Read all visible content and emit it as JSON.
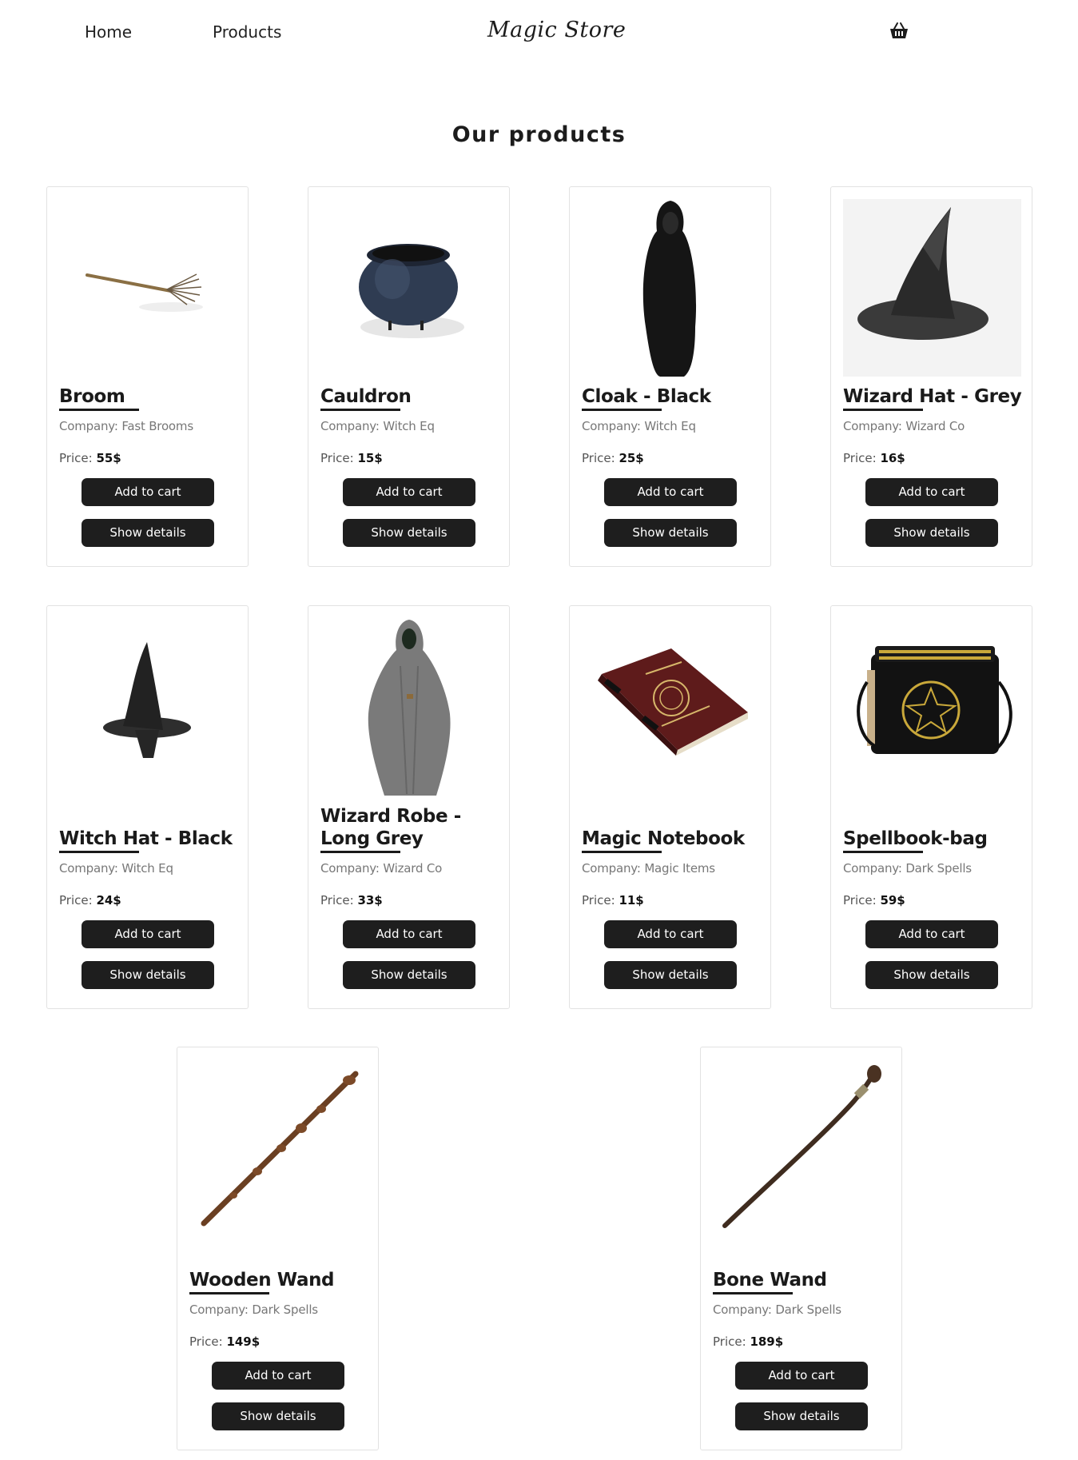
{
  "nav": {
    "home": "Home",
    "products": "Products",
    "logo": "Magic Store"
  },
  "icons": {
    "cart": "basket-icon"
  },
  "page": {
    "title": "Our products"
  },
  "labels": {
    "company": "Company:",
    "price": "Price:",
    "add_to_cart": "Add to cart",
    "show_details": "Show details"
  },
  "products": [
    {
      "name": "Broom",
      "company": "Fast Brooms",
      "price": "55$",
      "image": "broom"
    },
    {
      "name": "Cauldron",
      "company": "Witch Eq",
      "price": "15$",
      "image": "cauldron"
    },
    {
      "name": "Cloak - Black",
      "company": "Witch Eq",
      "price": "25$",
      "image": "cloak"
    },
    {
      "name": "Wizard Hat - Grey",
      "company": "Wizard Co",
      "price": "16$",
      "image": "wizard-hat"
    },
    {
      "name": "Witch Hat - Black",
      "company": "Witch Eq",
      "price": "24$",
      "image": "witch-hat"
    },
    {
      "name": "Wizard Robe - Long Grey",
      "company": "Wizard Co",
      "price": "33$",
      "image": "robe"
    },
    {
      "name": "Magic Notebook",
      "company": "Magic Items",
      "price": "11$",
      "image": "notebook"
    },
    {
      "name": "Spellbook-bag",
      "company": "Dark Spells",
      "price": "59$",
      "image": "bag"
    },
    {
      "name": "Wooden Wand",
      "company": "Dark Spells",
      "price": "149$",
      "image": "wooden-wand"
    },
    {
      "name": "Bone Wand",
      "company": "Dark Spells",
      "price": "189$",
      "image": "bone-wand"
    }
  ]
}
